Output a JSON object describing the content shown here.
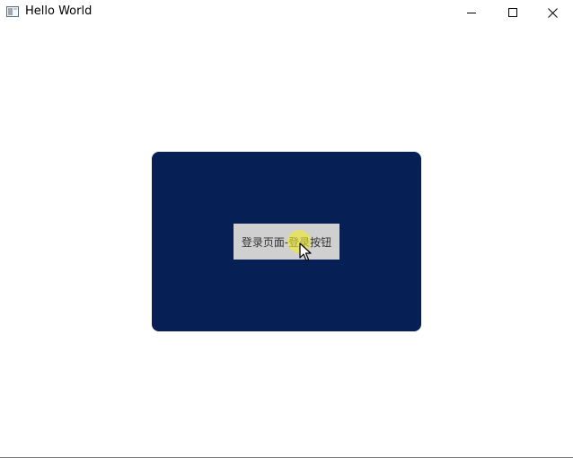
{
  "window": {
    "title": "Hello World",
    "icon": "app-window-icon",
    "controls": {
      "minimize_icon": "minimize-icon",
      "maximize_icon": "maximize-icon",
      "close_icon": "close-icon"
    }
  },
  "main": {
    "panel_color": "#061f55",
    "login_button": {
      "label": "登录页面-登录按钮",
      "background": "#d0d0d0"
    },
    "cursor": {
      "icon": "mouse-pointer-icon",
      "highlight_color": "#f0eb28"
    }
  }
}
